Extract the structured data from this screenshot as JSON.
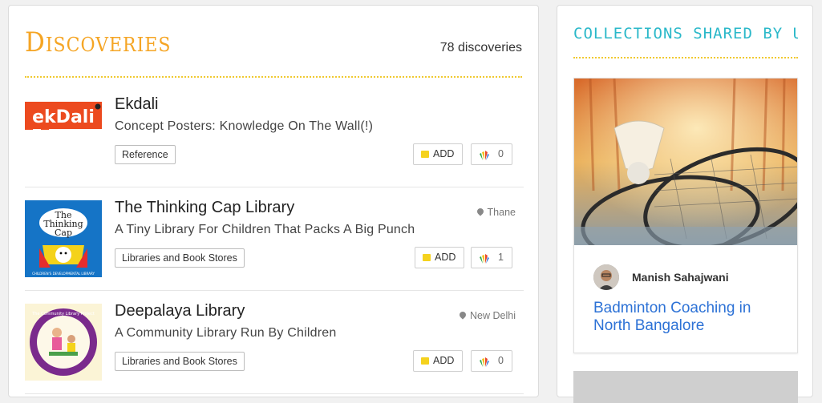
{
  "main": {
    "title": "Discoveries",
    "count": "78 discoveries",
    "items": [
      {
        "title": "Ekdali",
        "desc": "Concept Posters: Knowledge On The Wall(!)",
        "tag": "Reference",
        "location": "",
        "add": "ADD",
        "likes": "0",
        "logo_text": "ekDali"
      },
      {
        "title": "The Thinking Cap Library",
        "desc": "A Tiny Library For Children That Packs A Big Punch",
        "tag": "Libraries and Book Stores",
        "location": "Thane",
        "add": "ADD",
        "likes": "1",
        "logo_text": "The Thinking Cap",
        "logo_sub": "CHILDREN'S DEVELOPMENTAL LIBRARY"
      },
      {
        "title": "Deepalaya Library",
        "desc": "A Community Library Run By Children",
        "tag": "Libraries and Book Stores",
        "location": "New Delhi",
        "add": "ADD",
        "likes": "0",
        "logo_text": "The Community Library Project"
      }
    ]
  },
  "side": {
    "title": "COLLECTIONS SHARED BY USERS",
    "card": {
      "author": "Manish Sahajwani",
      "title": "Badminton Coaching in North Bangalore"
    }
  },
  "colors": {
    "accent_orange": "#f5a524",
    "accent_teal": "#2ab8c9",
    "link_blue": "#2d72d6",
    "add_yellow": "#f5d21e"
  }
}
